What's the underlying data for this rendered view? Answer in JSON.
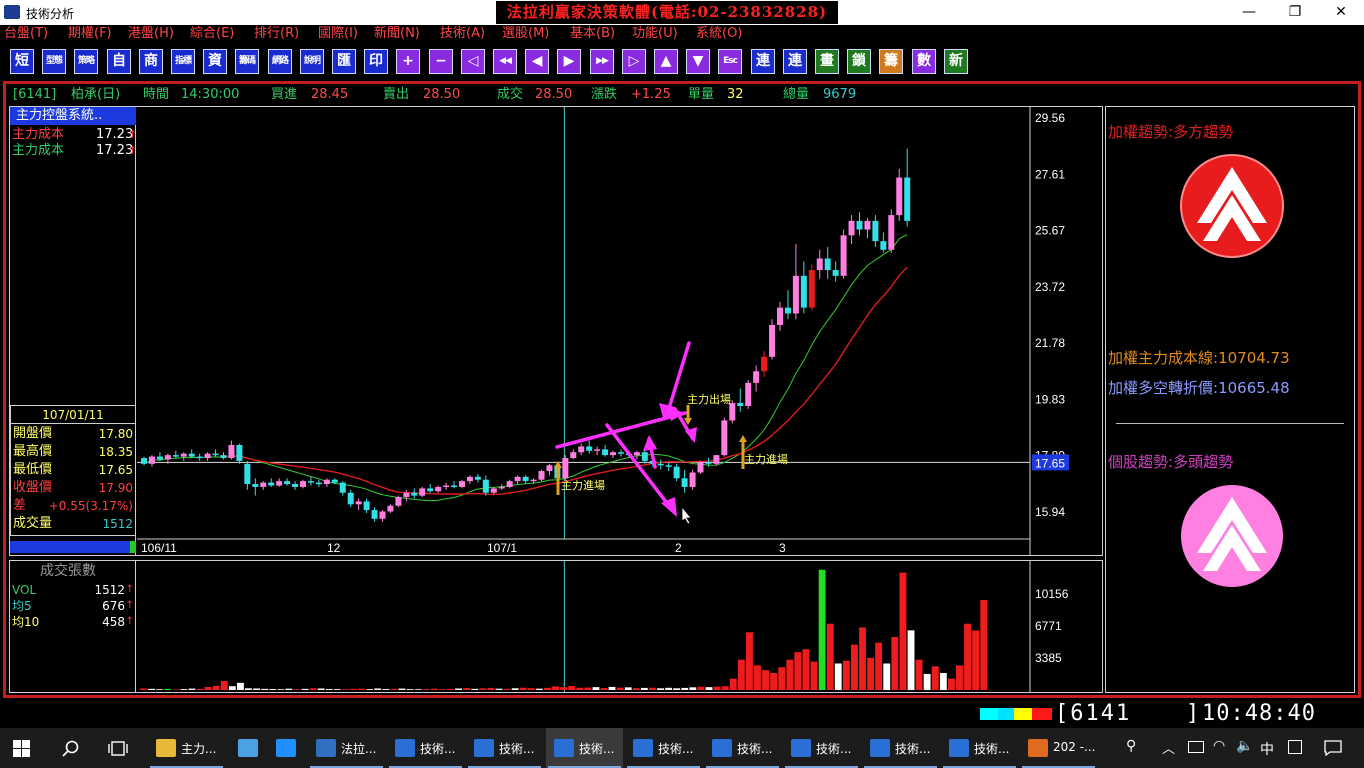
{
  "window": {
    "title": "技術分析",
    "banner": "法拉利贏家決策軟體(電話:02-23832828)",
    "minimize": "—",
    "maximize": "❐",
    "close": "✕"
  },
  "menu": [
    "台盤(T)",
    "期權(F)",
    "港盤(H)",
    "綜合(E)",
    "排行(R)",
    "國際(I)",
    "新聞(N)",
    "技術(A)",
    "選股(M)",
    "基本(B)",
    "功能(U)",
    "系統(O)"
  ],
  "toolbar": [
    "短",
    "型態",
    "策略",
    "自",
    "商",
    "指標",
    "資",
    "籌碼",
    "網路",
    "說明",
    "匯",
    "印",
    "+",
    "−",
    "◁",
    "◀◀",
    "◀",
    "▶",
    "▶▶",
    "▷",
    "▲",
    "▼",
    "Esc",
    "連",
    "連",
    "畫",
    "鎖",
    "籌",
    "數",
    "新"
  ],
  "quote": {
    "code": "[6141]",
    "name": "柏承(日)",
    "time_label": "時間",
    "time": "14:30:00",
    "bid_label": "買進",
    "bid": "28.45",
    "ask_label": "賣出",
    "ask": "28.50",
    "last_label": "成交",
    "last": "28.50",
    "change_label": "漲跌",
    "change": "+1.25",
    "vol_label": "單量",
    "vol": "32",
    "total_label": "總量",
    "total": "9679"
  },
  "left_panel": {
    "system_title": "主力控盤系統..",
    "cost1_label": "主力成本",
    "cost1_value": "17.23",
    "cost2_label": "主力成本",
    "cost2_value": "17.23",
    "arrow_up": "↑",
    "date": "107/01/11",
    "rows": [
      {
        "label": "開盤價",
        "value": "17.80"
      },
      {
        "label": "最高價",
        "value": "18.35"
      },
      {
        "label": "最低價",
        "value": "17.65"
      },
      {
        "label": "收盤價",
        "value": "17.90"
      },
      {
        "label": "差",
        "value": "+0.55(3.17%)"
      },
      {
        "label": "成交量",
        "value": "1512"
      }
    ]
  },
  "volume_panel": {
    "title": "成交張數",
    "rows": [
      {
        "label": "VOL",
        "value": "1512"
      },
      {
        "label": "均5",
        "value": "676"
      },
      {
        "label": "均10",
        "value": "458"
      }
    ]
  },
  "price_axis": [
    "29.56",
    "27.61",
    "25.67",
    "23.72",
    "21.78",
    "19.83",
    "17.89",
    "15.94"
  ],
  "crosshair_price": "17.65",
  "volume_axis": [
    "10156",
    "6771",
    "3385"
  ],
  "x_labels": [
    "106/11",
    "12",
    "107/1",
    "2",
    "3"
  ],
  "annotations": {
    "enter1": "主力進場",
    "exit": "主力出場",
    "enter2": "主力進場"
  },
  "right_panel": {
    "index_trend_label": "加權趨勢:",
    "index_trend_value": "多方趨勢",
    "cost_line_label": "加權主力成本線:",
    "cost_line_value": "10704.73",
    "pivot_label": "加權多空轉折價:",
    "pivot_value": "10665.48",
    "stock_trend_label": "個股趨勢:",
    "stock_trend_value": "多頭趨勢"
  },
  "status": {
    "code": "[6141",
    "close_bracket": "]",
    "clock": "10:48:40"
  },
  "taskbar": {
    "items": [
      "主力...",
      "",
      "",
      "法拉...",
      "技術...",
      "技術...",
      "技術...",
      "技術...",
      "技術...",
      "技術...",
      "技術...",
      "技術...",
      "202 -..."
    ],
    "tray_lang": "中"
  },
  "chart_data": {
    "type": "candlestick",
    "price_range": [
      15.0,
      29.8
    ],
    "candles": [
      [
        17.8,
        17.85,
        17.55,
        17.6
      ],
      [
        17.6,
        17.9,
        17.5,
        17.85
      ],
      [
        17.85,
        18.0,
        17.7,
        17.75
      ],
      [
        17.75,
        17.95,
        17.6,
        17.9
      ],
      [
        17.9,
        18.05,
        17.8,
        17.85
      ],
      [
        17.85,
        18.0,
        17.7,
        17.95
      ],
      [
        17.95,
        18.1,
        17.8,
        17.85
      ],
      [
        17.85,
        17.95,
        17.7,
        17.8
      ],
      [
        17.8,
        18.0,
        17.7,
        17.95
      ],
      [
        17.95,
        18.1,
        17.85,
        17.9
      ],
      [
        17.9,
        18.0,
        17.75,
        17.8
      ],
      [
        17.8,
        18.4,
        17.75,
        18.25
      ],
      [
        18.25,
        18.3,
        17.6,
        17.7
      ],
      [
        17.6,
        17.7,
        16.7,
        16.9
      ],
      [
        16.9,
        17.1,
        16.5,
        16.8
      ],
      [
        16.8,
        17.0,
        16.7,
        16.95
      ],
      [
        16.95,
        17.1,
        16.8,
        16.85
      ],
      [
        16.85,
        17.1,
        16.8,
        17.0
      ],
      [
        17.0,
        17.1,
        16.85,
        16.9
      ],
      [
        16.9,
        17.0,
        16.7,
        16.8
      ],
      [
        16.8,
        17.05,
        16.75,
        17.0
      ],
      [
        17.0,
        17.15,
        16.85,
        16.95
      ],
      [
        16.95,
        17.05,
        16.8,
        16.9
      ],
      [
        16.9,
        17.1,
        16.8,
        17.05
      ],
      [
        17.05,
        17.1,
        16.9,
        16.95
      ],
      [
        16.95,
        17.0,
        16.5,
        16.6
      ],
      [
        16.6,
        16.7,
        16.1,
        16.2
      ],
      [
        16.2,
        16.4,
        16.0,
        16.3
      ],
      [
        16.3,
        16.4,
        15.9,
        16.0
      ],
      [
        16.0,
        16.1,
        15.6,
        15.7
      ],
      [
        15.7,
        16.0,
        15.6,
        15.95
      ],
      [
        15.95,
        16.2,
        15.9,
        16.15
      ],
      [
        16.15,
        16.5,
        16.1,
        16.45
      ],
      [
        16.45,
        16.7,
        16.3,
        16.6
      ],
      [
        16.6,
        16.75,
        16.4,
        16.5
      ],
      [
        16.5,
        16.8,
        16.45,
        16.75
      ],
      [
        16.75,
        16.9,
        16.6,
        16.65
      ],
      [
        16.65,
        16.85,
        16.6,
        16.8
      ],
      [
        16.8,
        16.95,
        16.7,
        16.85
      ],
      [
        16.85,
        17.0,
        16.75,
        16.8
      ],
      [
        16.8,
        17.05,
        16.75,
        17.0
      ],
      [
        17.0,
        17.2,
        16.9,
        17.15
      ],
      [
        17.15,
        17.25,
        16.95,
        17.05
      ],
      [
        17.05,
        17.2,
        16.5,
        16.6
      ],
      [
        16.6,
        16.8,
        16.55,
        16.75
      ],
      [
        16.75,
        16.9,
        16.7,
        16.8
      ],
      [
        16.8,
        17.05,
        16.75,
        17.0
      ],
      [
        17.0,
        17.2,
        16.9,
        17.15
      ],
      [
        17.15,
        17.2,
        16.9,
        17.0
      ],
      [
        17.0,
        17.1,
        16.9,
        17.05
      ],
      [
        17.05,
        17.4,
        17.0,
        17.35
      ],
      [
        17.35,
        17.6,
        17.2,
        17.55
      ],
      [
        17.55,
        17.6,
        17.0,
        17.1
      ],
      [
        17.1,
        17.9,
        17.05,
        17.8
      ],
      [
        17.8,
        18.1,
        17.75,
        18.0
      ],
      [
        18.0,
        18.3,
        17.9,
        18.2
      ],
      [
        18.2,
        18.4,
        17.95,
        18.05
      ],
      [
        18.05,
        18.2,
        17.9,
        18.1
      ],
      [
        18.1,
        18.25,
        17.85,
        17.9
      ],
      [
        17.9,
        18.05,
        17.8,
        18.0
      ],
      [
        18.0,
        18.1,
        17.85,
        17.95
      ],
      [
        17.95,
        18.05,
        17.8,
        17.9
      ],
      [
        17.9,
        18.05,
        17.75,
        18.0
      ],
      [
        18.0,
        18.1,
        17.6,
        17.7
      ],
      [
        17.7,
        17.8,
        17.5,
        17.6
      ],
      [
        17.6,
        17.75,
        17.4,
        17.55
      ],
      [
        17.55,
        17.65,
        17.35,
        17.5
      ],
      [
        17.5,
        17.6,
        17.0,
        17.1
      ],
      [
        17.1,
        17.4,
        16.6,
        16.8
      ],
      [
        16.8,
        17.4,
        16.7,
        17.3
      ],
      [
        17.3,
        17.7,
        17.25,
        17.65
      ],
      [
        17.65,
        17.8,
        17.5,
        17.6
      ],
      [
        17.6,
        17.9,
        17.55,
        17.9
      ],
      [
        17.9,
        19.2,
        17.85,
        19.1
      ],
      [
        19.1,
        19.8,
        19.0,
        19.7
      ],
      [
        19.7,
        20.2,
        19.4,
        19.6
      ],
      [
        19.6,
        20.5,
        19.5,
        20.4
      ],
      [
        20.4,
        21.0,
        20.1,
        20.8
      ],
      [
        20.8,
        21.5,
        20.6,
        21.3
      ],
      [
        21.3,
        22.6,
        21.2,
        22.4
      ],
      [
        22.4,
        23.2,
        22.2,
        23.0
      ],
      [
        23.0,
        23.6,
        22.6,
        22.8
      ],
      [
        22.8,
        25.2,
        22.6,
        24.1
      ],
      [
        24.1,
        24.6,
        22.8,
        23.0
      ],
      [
        23.0,
        24.5,
        22.9,
        24.3
      ],
      [
        24.3,
        25.0,
        24.0,
        24.7
      ],
      [
        24.7,
        25.1,
        24.0,
        24.3
      ],
      [
        24.3,
        24.6,
        23.9,
        24.1
      ],
      [
        24.1,
        25.7,
        24.0,
        25.5
      ],
      [
        25.5,
        26.2,
        25.2,
        26.0
      ],
      [
        26.0,
        26.3,
        25.5,
        25.7
      ],
      [
        25.7,
        26.1,
        25.4,
        26.0
      ],
      [
        26.0,
        26.2,
        25.1,
        25.3
      ],
      [
        25.3,
        25.6,
        24.9,
        25.0
      ],
      [
        25.0,
        26.4,
        24.9,
        26.2
      ],
      [
        26.2,
        27.8,
        26.0,
        27.5
      ],
      [
        27.5,
        28.5,
        25.8,
        26.0
      ]
    ],
    "volumes": [
      [
        160,
        "r"
      ],
      [
        120,
        "w"
      ],
      [
        80,
        "w"
      ],
      [
        120,
        "g"
      ],
      [
        60,
        "r"
      ],
      [
        90,
        "w"
      ],
      [
        150,
        "w"
      ],
      [
        120,
        "r"
      ],
      [
        320,
        "r"
      ],
      [
        450,
        "r"
      ],
      [
        950,
        "r"
      ],
      [
        400,
        "w"
      ],
      [
        760,
        "w"
      ],
      [
        180,
        "w"
      ],
      [
        160,
        "w"
      ],
      [
        120,
        "w"
      ],
      [
        100,
        "w"
      ],
      [
        80,
        "w"
      ],
      [
        140,
        "w"
      ],
      [
        90,
        "r"
      ],
      [
        120,
        "w"
      ],
      [
        180,
        "r"
      ],
      [
        160,
        "w"
      ],
      [
        100,
        "w"
      ],
      [
        90,
        "w"
      ],
      [
        80,
        "r"
      ],
      [
        120,
        "r"
      ],
      [
        140,
        "r"
      ],
      [
        90,
        "w"
      ],
      [
        160,
        "w"
      ],
      [
        100,
        "w"
      ],
      [
        120,
        "r"
      ],
      [
        150,
        "w"
      ],
      [
        90,
        "w"
      ],
      [
        80,
        "w"
      ],
      [
        100,
        "r"
      ],
      [
        140,
        "r"
      ],
      [
        90,
        "r"
      ],
      [
        120,
        "r"
      ],
      [
        160,
        "w"
      ],
      [
        200,
        "r"
      ],
      [
        120,
        "w"
      ],
      [
        180,
        "r"
      ],
      [
        220,
        "r"
      ],
      [
        140,
        "w"
      ],
      [
        120,
        "r"
      ],
      [
        180,
        "w"
      ],
      [
        240,
        "r"
      ],
      [
        190,
        "r"
      ],
      [
        140,
        "w"
      ],
      [
        230,
        "r"
      ],
      [
        380,
        "r"
      ],
      [
        300,
        "r"
      ],
      [
        420,
        "r"
      ],
      [
        240,
        "r"
      ],
      [
        260,
        "r"
      ],
      [
        300,
        "w"
      ],
      [
        200,
        "r"
      ],
      [
        330,
        "w"
      ],
      [
        250,
        "r"
      ],
      [
        280,
        "w"
      ],
      [
        190,
        "r"
      ],
      [
        220,
        "w"
      ],
      [
        240,
        "r"
      ],
      [
        180,
        "w"
      ],
      [
        230,
        "w"
      ],
      [
        180,
        "w"
      ],
      [
        220,
        "w"
      ],
      [
        280,
        "w"
      ],
      [
        350,
        "r"
      ],
      [
        300,
        "w"
      ],
      [
        360,
        "r"
      ],
      [
        400,
        "r"
      ],
      [
        1200,
        "r"
      ],
      [
        3200,
        "r"
      ],
      [
        6100,
        "r"
      ],
      [
        2600,
        "r"
      ],
      [
        2100,
        "r"
      ],
      [
        1800,
        "r"
      ],
      [
        2400,
        "r"
      ],
      [
        3200,
        "r"
      ],
      [
        4000,
        "r"
      ],
      [
        4300,
        "r"
      ],
      [
        3000,
        "r"
      ],
      [
        12700,
        "g"
      ],
      [
        7000,
        "r"
      ],
      [
        2800,
        "w"
      ],
      [
        3100,
        "r"
      ],
      [
        4800,
        "r"
      ],
      [
        6600,
        "r"
      ],
      [
        3400,
        "r"
      ],
      [
        5000,
        "r"
      ],
      [
        2800,
        "w"
      ],
      [
        5600,
        "r"
      ],
      [
        12400,
        "r"
      ],
      [
        6300,
        "w"
      ],
      [
        3200,
        "r"
      ],
      [
        1700,
        "w"
      ],
      [
        2500,
        "r"
      ],
      [
        1800,
        "w"
      ],
      [
        1200,
        "r"
      ],
      [
        2600,
        "r"
      ],
      [
        7000,
        "r"
      ],
      [
        6300,
        "r"
      ],
      [
        9500,
        "r"
      ]
    ],
    "volume_max": 13200
  }
}
